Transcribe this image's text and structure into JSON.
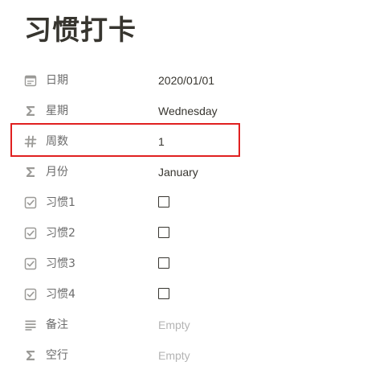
{
  "page": {
    "title": "习惯打卡"
  },
  "properties": [
    {
      "name": "日期",
      "icon": "calendar-icon",
      "value": "2020/01/01",
      "kind": "text"
    },
    {
      "name": "星期",
      "icon": "formula-sigma-icon",
      "value": "Wednesday",
      "kind": "text"
    },
    {
      "name": "周数",
      "icon": "number-hash-icon",
      "value": "1",
      "kind": "text"
    },
    {
      "name": "月份",
      "icon": "formula-sigma-icon",
      "value": "January",
      "kind": "text"
    },
    {
      "name": "习惯1",
      "icon": "checkbox-property-icon",
      "checked": false,
      "kind": "checkbox"
    },
    {
      "name": "习惯2",
      "icon": "checkbox-property-icon",
      "checked": false,
      "kind": "checkbox"
    },
    {
      "name": "习惯3",
      "icon": "checkbox-property-icon",
      "checked": false,
      "kind": "checkbox"
    },
    {
      "name": "习惯4",
      "icon": "checkbox-property-icon",
      "checked": false,
      "kind": "checkbox"
    },
    {
      "name": "备注",
      "icon": "text-lines-icon",
      "value": "Empty",
      "kind": "empty"
    },
    {
      "name": "空行",
      "icon": "formula-sigma-icon",
      "value": "Empty",
      "kind": "empty"
    }
  ],
  "highlight": {
    "property": "周数",
    "color": "#e02020"
  },
  "colors": {
    "text": "#37352f",
    "label": "#6b6b6b",
    "icon": "#9b9a97",
    "empty": "#b4b4b4"
  }
}
